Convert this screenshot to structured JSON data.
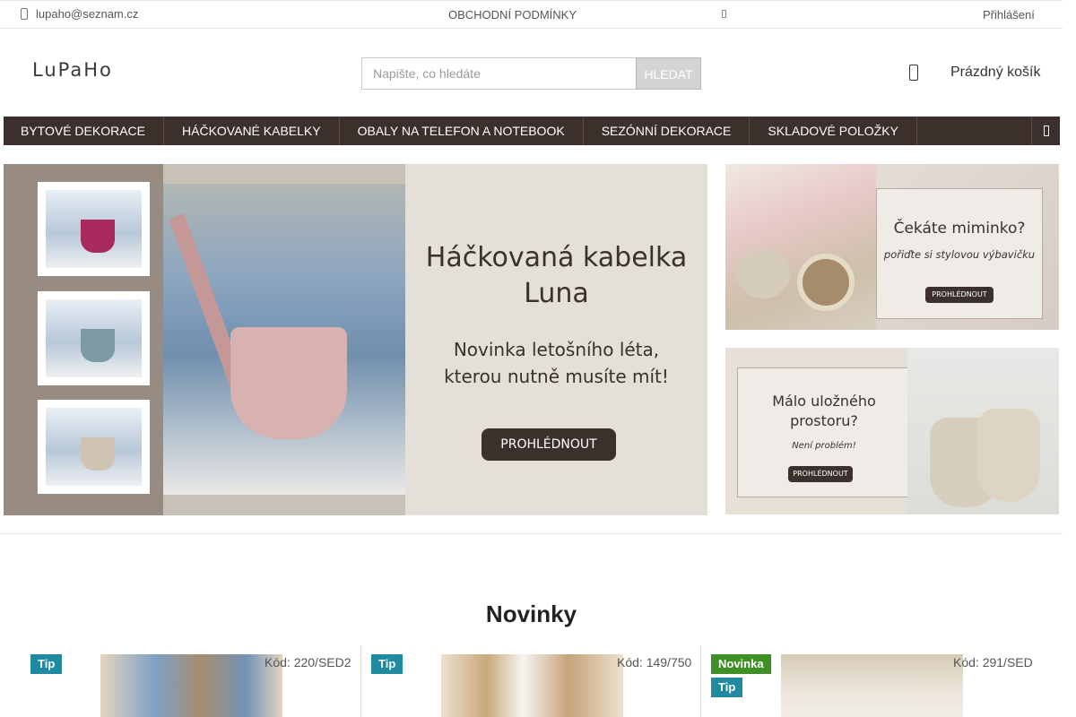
{
  "topbar": {
    "email": "lupaho@seznam.cz",
    "terms_label": "OBCHODNÍ PODMÍNKY",
    "login_label": "Přihlášení"
  },
  "header": {
    "logo_text": "LuPaHo",
    "search": {
      "placeholder": "Napište, co hledáte",
      "button_label": "HLEDAT"
    },
    "cart_label": "Prázdný košík"
  },
  "nav": {
    "items": [
      {
        "label": "BYTOVÉ DEKORACE"
      },
      {
        "label": "HÁČKOVANÉ KABELKY"
      },
      {
        "label": "OBALY NA TELEFON A NOTEBOOK"
      },
      {
        "label": "SEZÓNNÍ DEKORACE"
      },
      {
        "label": "SKLADOVÉ POLOŽKY"
      }
    ]
  },
  "banners": {
    "main": {
      "title_line1": "Háčkovaná kabelka",
      "title_line2": "Luna",
      "subtitle_line1": "Novinka letošního léta,",
      "subtitle_line2": "kterou nutně musíte mít!",
      "button_label": "PROHLÉDNOUT"
    },
    "side1": {
      "title": "Čekáte miminko?",
      "subtitle": "pořiďte si stylovou výbavičku",
      "button_label": "PROHLÉDNOUT"
    },
    "side2": {
      "title_line1": "Málo uložného",
      "title_line2": "prostoru?",
      "subtitle": "Není problém!",
      "button_label": "PROHLÉDNOUT"
    }
  },
  "products_section": {
    "title": "Novinky",
    "items": [
      {
        "badges": [
          "Tip"
        ],
        "code": "Kód: 220/SED2"
      },
      {
        "badges": [
          "Tip"
        ],
        "code": "Kód: 149/750"
      },
      {
        "badges": [
          "Novinka",
          "Tip"
        ],
        "code": "Kód: 291/SED"
      }
    ]
  },
  "colors": {
    "nav_background": "#3b302c",
    "tip_badge": "#1f8aa0",
    "new_badge": "#3d8f26"
  },
  "icons": {
    "email": "phone-icon",
    "cart": "bag-icon",
    "nav_more": "menu-icon"
  }
}
